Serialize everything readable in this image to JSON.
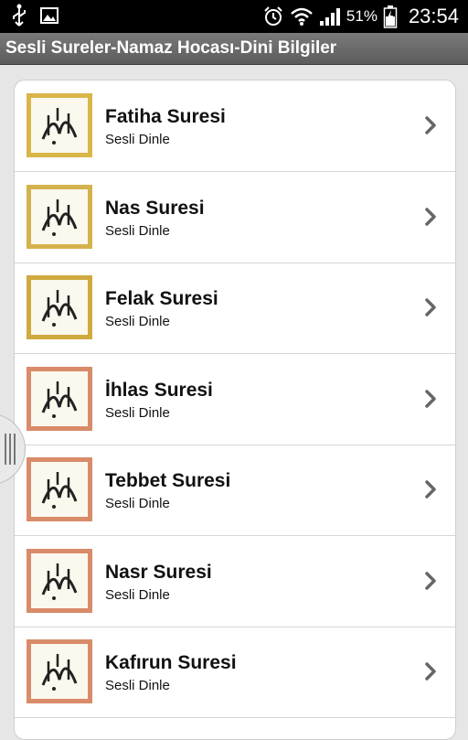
{
  "statusbar": {
    "icons_left": [
      "usb-icon",
      "image-icon"
    ],
    "icons_right": [
      "alarm-icon",
      "wifi-icon",
      "signal-icon",
      "battery-charging-icon"
    ],
    "battery_percent": "51%",
    "time": "23:54"
  },
  "app": {
    "title": "Sesli Sureler-Namaz Hocası-Dini Bilgiler"
  },
  "list": {
    "items": [
      {
        "title": "Fatiha Suresi",
        "subtitle": "Sesli Dinle",
        "frame_color": "#d9b64a"
      },
      {
        "title": "Nas Suresi",
        "subtitle": "Sesli Dinle",
        "frame_color": "#d4b24c"
      },
      {
        "title": "Felak Suresi",
        "subtitle": "Sesli Dinle",
        "frame_color": "#cfaa3e"
      },
      {
        "title": "İhlas Suresi",
        "subtitle": "Sesli Dinle",
        "frame_color": "#d98b6a"
      },
      {
        "title": "Tebbet Suresi",
        "subtitle": "Sesli Dinle",
        "frame_color": "#d98b6a"
      },
      {
        "title": "Nasr Suresi",
        "subtitle": "Sesli Dinle",
        "frame_color": "#d98b6a"
      },
      {
        "title": "Kafırun Suresi",
        "subtitle": "Sesli Dinle",
        "frame_color": "#d98b6a"
      }
    ]
  }
}
